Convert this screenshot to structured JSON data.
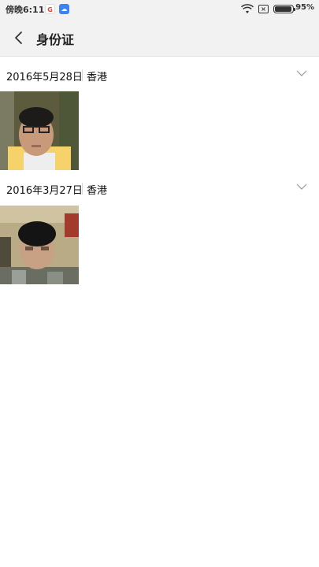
{
  "status_bar": {
    "time": "傍晚6:11",
    "app_icons": [
      "google-icon",
      "cloud-icon"
    ],
    "battery": "95%",
    "battery_level": 0.95
  },
  "header": {
    "back_icon": "chevron-left-icon",
    "title": "身份证"
  },
  "groups": [
    {
      "date": "2016年5月28日",
      "location": "香港"
    },
    {
      "date": "2016年3月27日",
      "location": "香港"
    }
  ],
  "colors": {
    "bar_background": "#f2f2f2",
    "page_background": "#ffffff",
    "separator": "#d7d7d7"
  }
}
